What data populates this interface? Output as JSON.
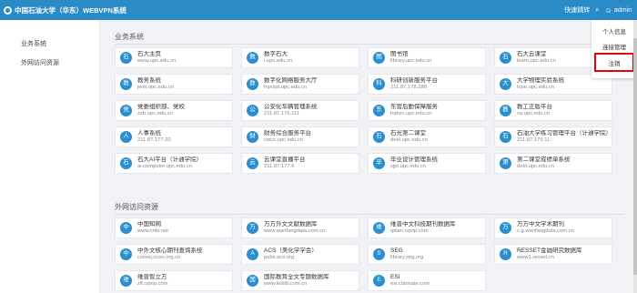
{
  "header": {
    "title": "中国石油大学（华东）WEBVPN系统",
    "quick_jump": "快速跳转",
    "user": "admin"
  },
  "sidebar": {
    "items": [
      {
        "label": "业务系统"
      },
      {
        "label": "外网访问资源"
      }
    ]
  },
  "user_menu": {
    "items": [
      {
        "label": "个人信息"
      },
      {
        "label": "连接管理"
      }
    ],
    "logout": "注销"
  },
  "sections": [
    {
      "title": "业务系统",
      "cards": [
        {
          "icon": "石",
          "name": "石大主页",
          "url": "www.upc.edu.cn"
        },
        {
          "icon": "数",
          "name": "数字石大",
          "url": "i.upc.edu.cn"
        },
        {
          "icon": "图",
          "name": "图书馆",
          "url": "library.upc.edu.cn"
        },
        {
          "icon": "石",
          "name": "石大云课堂",
          "url": "learn.upc.edu.cn"
        },
        {
          "icon": "教",
          "name": "教务系统",
          "url": "jwxt.upc.edu.cn"
        },
        {
          "icon": "数",
          "name": "数字化网络服务大厅",
          "url": "hqszpt.upc.edu.cn"
        },
        {
          "icon": "科",
          "name": "科研创新服务平台",
          "url": "211.87.178.188"
        },
        {
          "icon": "大",
          "name": "大学物理实验系统",
          "url": "tcpe.upc.edu.cn"
        },
        {
          "icon": "党",
          "name": "党委组织部、党校",
          "url": "zzb.upc.edu.cn"
        },
        {
          "icon": "公",
          "name": "公安化车辆管理系统",
          "url": "211.87.176.111"
        },
        {
          "icon": "东",
          "name": "东营后勤保障服务",
          "url": "hqbzc.upc.edu.cn"
        },
        {
          "icon": "教",
          "name": "教工正版平台",
          "url": "ca.upc.edu.cn"
        },
        {
          "icon": "人",
          "name": "人事系统",
          "url": "211.87.177.20"
        },
        {
          "icon": "财",
          "name": "财务综合服务平台",
          "url": "cwcx.upc.edu.cn"
        },
        {
          "icon": "石",
          "name": "石光第二课堂",
          "url": "dekt.upc.edu.cn"
        },
        {
          "icon": "石",
          "name": "石油大学练习管理平台（计通学院）",
          "url": "211.87.179.11"
        },
        {
          "icon": "石",
          "name": "石大AI平台（计通学院）",
          "url": "ai.computer.upc.edu.cn"
        },
        {
          "icon": "云",
          "name": "云课堂直播平台",
          "url": "211.87.177.6"
        },
        {
          "icon": "毕",
          "name": "毕业设计管理系统",
          "url": "sjpt.upc.edu.cn"
        },
        {
          "icon": "第",
          "name": "第二课堂成绩单系统",
          "url": "dekt.upc.edu.cn"
        }
      ]
    },
    {
      "title": "外网访问资源",
      "cards": [
        {
          "icon": "中",
          "name": "中国知网",
          "url": "www.cnki.net"
        },
        {
          "icon": "万",
          "name": "万方外文文献数据库",
          "url": "www.wanfangdata.com.cn"
        },
        {
          "icon": "维",
          "name": "维普中文科技期刊数据库",
          "url": "qikan.cqvip.com"
        },
        {
          "icon": "万",
          "name": "万方中文学术期刊",
          "url": "c.g.wanfangdata.com.cn"
        },
        {
          "icon": "中",
          "name": "中外文核心期刊查询系统",
          "url": "coreej.cceu.org.cn"
        },
        {
          "icon": "A",
          "name": "ACS（美化学学会）",
          "url": "pubs.acs.org"
        },
        {
          "icon": "S",
          "name": "SEG",
          "url": "library.seg.org"
        },
        {
          "icon": "R",
          "name": "RESSET金融研究数据库",
          "url": "www1.resset.cn"
        },
        {
          "icon": "维",
          "name": "维普智立方",
          "url": "zlf.cqvip.com"
        },
        {
          "icon": "国",
          "name": "国际教育全文专题数据库",
          "url": "www.leslib.com.cn"
        },
        {
          "icon": "E",
          "name": "ESI",
          "url": "esi.clarivate.com"
        }
      ]
    }
  ],
  "colors": {
    "header_bg": "#2b8bc6",
    "badge_bg": "#2a8fd0",
    "logout_highlight": "#e60012"
  }
}
